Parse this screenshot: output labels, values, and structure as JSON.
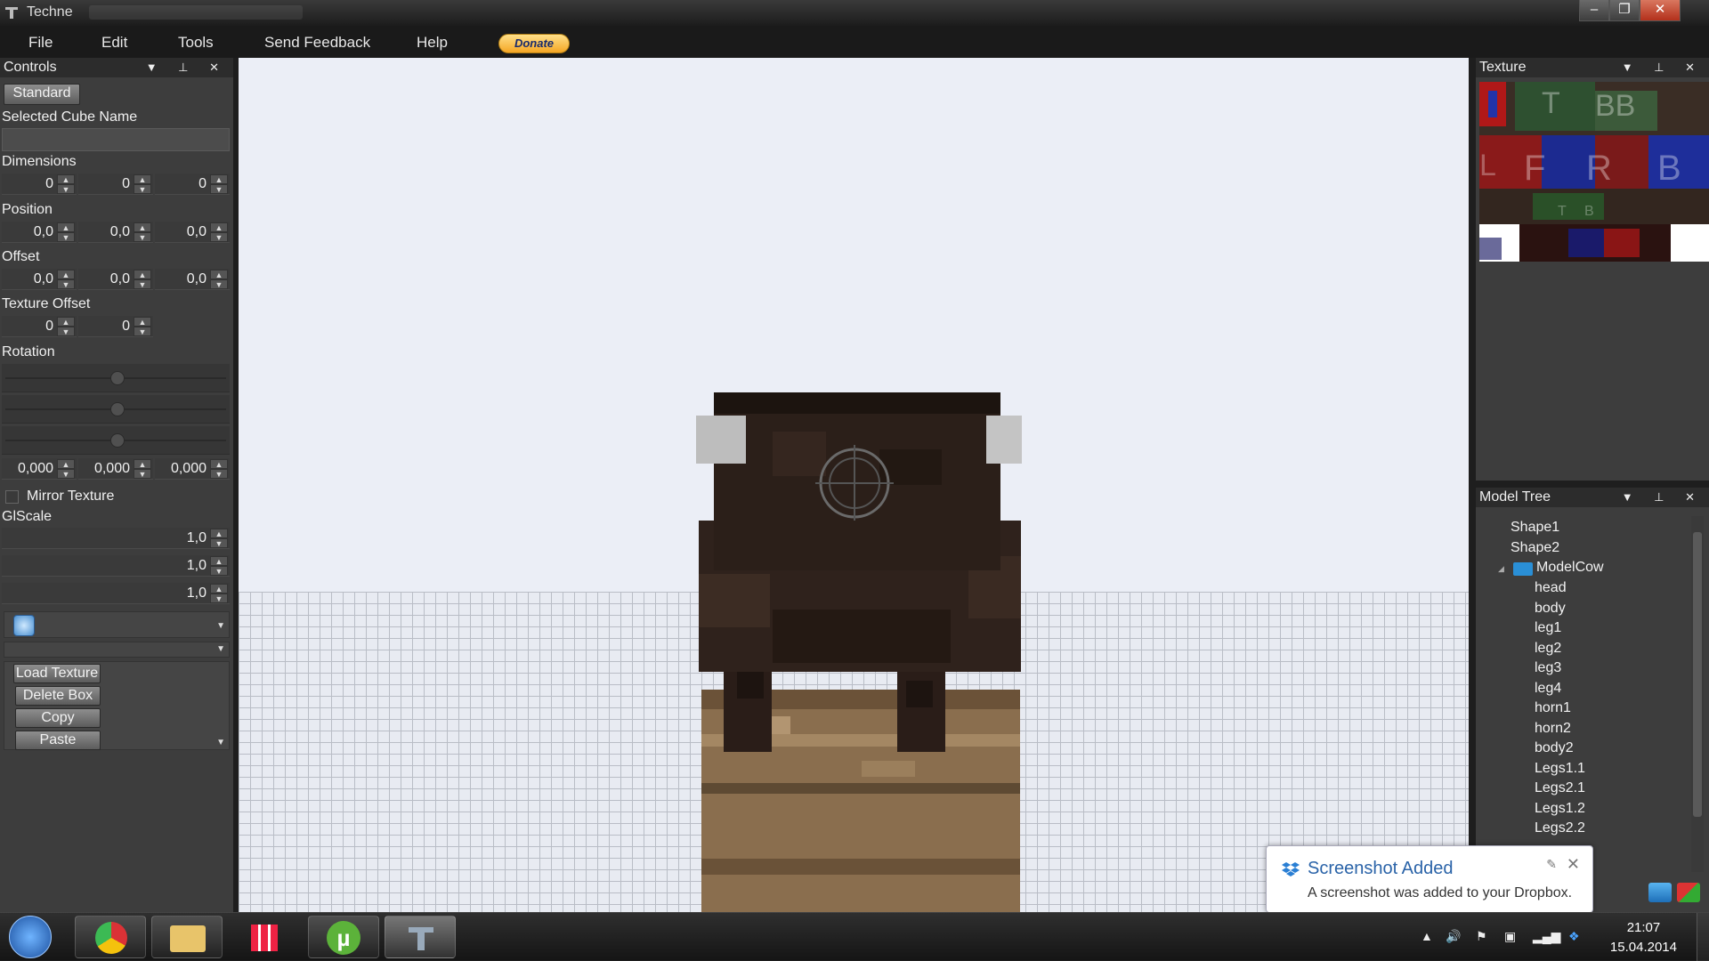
{
  "window": {
    "title": "Techne"
  },
  "menu": {
    "file": "File",
    "edit": "Edit",
    "tools": "Tools",
    "feedback": "Send Feedback",
    "help": "Help",
    "donate": "Donate"
  },
  "controls": {
    "title": "Controls",
    "mode_button": "Standard",
    "selected_cube_label": "Selected Cube Name",
    "selected_cube_value": "",
    "dimensions_label": "Dimensions",
    "dimensions": [
      "0",
      "0",
      "0"
    ],
    "position_label": "Position",
    "position": [
      "0,0",
      "0,0",
      "0,0"
    ],
    "offset_label": "Offset",
    "offset": [
      "0,0",
      "0,0",
      "0,0"
    ],
    "texture_offset_label": "Texture Offset",
    "texture_offset": [
      "0",
      "0"
    ],
    "rotation_label": "Rotation",
    "rotation": [
      "0,000",
      "0,000",
      "0,000"
    ],
    "mirror_label": "Mirror Texture",
    "glscale_label": "GlScale",
    "glscale": [
      "1,0",
      "1,0",
      "1,0"
    ],
    "load_texture": "Load Texture",
    "delete_box": "Delete Box",
    "copy": "Copy",
    "paste": "Paste"
  },
  "texture_panel": {
    "title": "Texture",
    "glyphs": [
      "T",
      "BB",
      "L",
      "F",
      "R",
      "B",
      "T",
      "B"
    ]
  },
  "model_tree": {
    "title": "Model Tree",
    "items": [
      "Shape1",
      "Shape2",
      "ModelCow",
      "head",
      "body",
      "leg1",
      "leg2",
      "leg3",
      "leg4",
      "horn1",
      "horn2",
      "body2",
      "Legs1.1",
      "Legs2.1",
      "Legs1.2",
      "Legs2.2"
    ]
  },
  "notification": {
    "title": "Screenshot Added",
    "body": "A screenshot was added to your Dropbox."
  },
  "taskbar": {
    "time": "21:07",
    "date": "15.04.2014"
  },
  "colors": {
    "accent": "#2a63a8",
    "donate": "#f5a623",
    "viewport": "#ebeef6"
  }
}
